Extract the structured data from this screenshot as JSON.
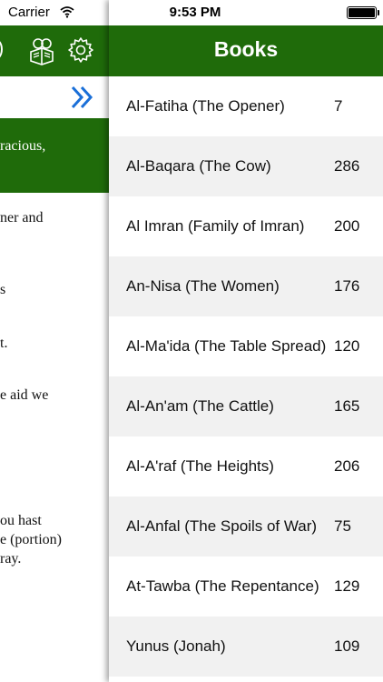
{
  "status_bar": {
    "carrier": "Carrier",
    "time": "9:53 PM"
  },
  "reader": {
    "header_partial": ")",
    "lines": [
      {
        "text": "racious,",
        "style": "white"
      },
      {
        "text": "ner and",
        "style": "dark"
      },
      {
        "text": "s",
        "style": "dark"
      },
      {
        "text": "t.",
        "style": "dark"
      },
      {
        "text": "e aid we",
        "style": "dark"
      },
      {
        "text": "ou hast",
        "style": "dark"
      },
      {
        "text": "e (portion)",
        "style": "dark"
      },
      {
        "text": "ray.",
        "style": "dark"
      }
    ]
  },
  "books": {
    "title": "Books",
    "items": [
      {
        "name": "Al-Fatiha (The Opener)",
        "count": "7"
      },
      {
        "name": "Al-Baqara (The Cow)",
        "count": "286"
      },
      {
        "name": "Al Imran (Family of Imran)",
        "count": "200"
      },
      {
        "name": "An-Nisa (The Women)",
        "count": "176"
      },
      {
        "name": "Al-Ma'ida (The Table Spread)",
        "count": "120"
      },
      {
        "name": "Al-An'am (The Cattle)",
        "count": "165"
      },
      {
        "name": "Al-A'raf (The Heights)",
        "count": "206"
      },
      {
        "name": "Al-Anfal (The Spoils of War)",
        "count": "75"
      },
      {
        "name": "At-Tawba (The Repentance)",
        "count": "129"
      },
      {
        "name": "Yunus (Jonah)",
        "count": "109"
      }
    ]
  },
  "icons": {
    "wifi": "wifi-icon",
    "battery": "battery-icon",
    "book": "book-icon",
    "gear": "gear-icon",
    "next": "double-chevron-right-icon"
  },
  "colors": {
    "header_green": "#1f6b0a",
    "chevron_blue": "#1a6fd8"
  }
}
